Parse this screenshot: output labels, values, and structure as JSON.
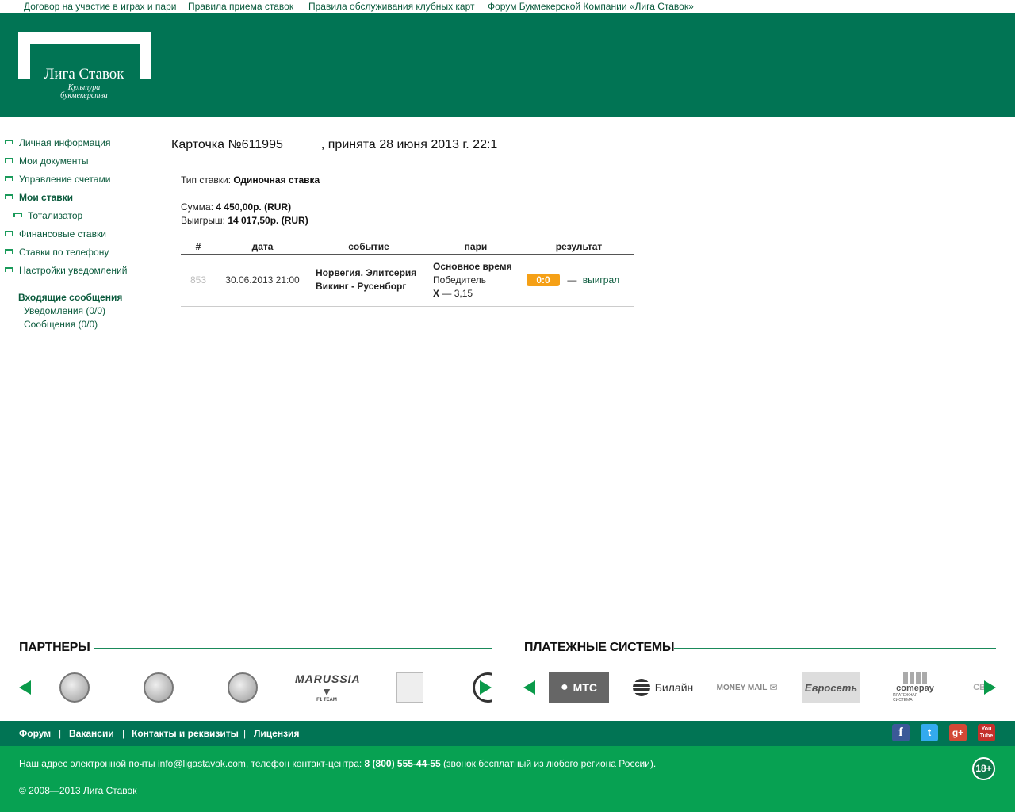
{
  "top_links": [
    "Договор на участие в играх и пари",
    "Правила приема ставок",
    "Правила обслуживания клубных карт",
    "Форум Букмекерской Компании «Лига Ставок»"
  ],
  "logo": {
    "name": "Лига Ставок",
    "tagline_1": "Культура",
    "tagline_2": "букмекерства"
  },
  "sidebar": {
    "items": [
      "Личная информация",
      "Мои документы",
      "Управление счетами",
      "Мои ставки",
      "Тотализатор",
      "Финансовые ставки",
      "Ставки по телефону",
      "Настройки уведомлений"
    ],
    "messages_heading": "Входящие сообщения",
    "notifications": "Уведомления (0/0)",
    "messages": "Сообщения (0/0)"
  },
  "card": {
    "title_pre": "Карточка №611995",
    "title_post": ", принята 28 июня 2013 г. 22:1",
    "bet_type_label": "Тип ставки:",
    "bet_type_value": "Одиночная ставка",
    "sum_label": "Сумма:",
    "sum_value": "4 450,00р. (RUR)",
    "win_label": "Выигрыш:",
    "win_value": "14 017,50р. (RUR)"
  },
  "table": {
    "headers": [
      "#",
      "дата",
      "событие",
      "пари",
      "результат"
    ],
    "rows": [
      {
        "id": "853",
        "date": "30.06.2013 21:00",
        "event_1": "Норвегия. Элитсерия",
        "event_2": "Викинг - Русенборг",
        "bet_1": "Основное время",
        "bet_2": "Победитель",
        "bet_3_outcome": "X",
        "bet_3_odds": "— 3,15",
        "score": "0:0",
        "dash": "—",
        "result": "выиграл"
      }
    ]
  },
  "partners_title": "ПАРТНЕРЫ",
  "partner_marussia": "MARUSSIA",
  "partner_marussia_sub": "F1 TEAM",
  "payments_title": "ПЛАТЕЖНЫЕ СИСТЕМЫ",
  "payments": {
    "mts": "МТС",
    "beeline": "Билайн",
    "money_mail": "MONEY MAIL",
    "euroset": "Евросеть",
    "comepay": "comepay",
    "comepay_sub": "ПЛАТЕЖНАЯ СИСТЕМА",
    "cut": "СВЯ"
  },
  "footer_links": [
    "Форум",
    "Вакансии",
    "Контакты и реквизиты",
    "Лицензия"
  ],
  "footer_sep": "|",
  "social": {
    "facebook": "f",
    "twitter": "t",
    "gplus": "g+",
    "youtube": "You Tube"
  },
  "footer": {
    "contact_pre": "Наш адрес электронной почты info@ligastavok.com, телефон контакт-центра: ",
    "phone": "8 (800) 555-44-55",
    "contact_post": " (звонок бесплатный из любого региона России).",
    "copyright": "© 2008—2013 Лига Ставок",
    "age": "18+"
  },
  "colors": {
    "header_green": "#017454",
    "footer_green": "#07a152",
    "result_orange": "#f5a016"
  }
}
